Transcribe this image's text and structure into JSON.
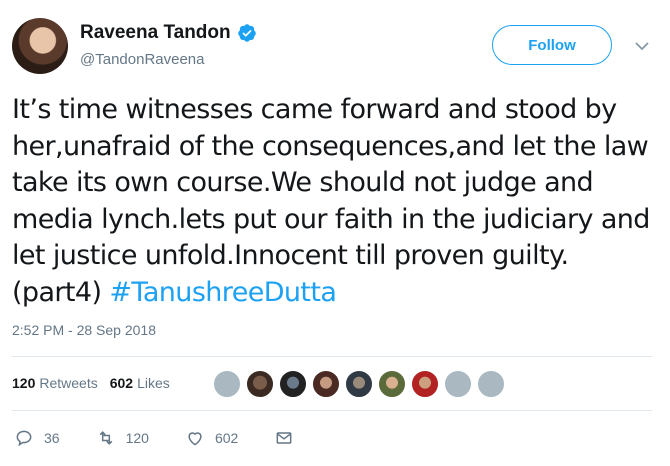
{
  "user": {
    "display_name": "Raveena Tandon",
    "handle": "@TandonRaveena",
    "verified": true
  },
  "follow_label": "Follow",
  "tweet": {
    "text": "It’s time witnesses came forward and stood by her,unafraid of the consequences,and let the law take its own course.We should not judge and media lynch.lets  put our faith in the judiciary and let justice unfold.Innocent till proven guilty.(part4) ",
    "hashtag": "#TanushreeDutta",
    "timestamp": "2:52 PM - 28 Sep 2018"
  },
  "stats": {
    "retweets_count": "120",
    "retweets_label": "Retweets",
    "likes_count": "602",
    "likes_label": "Likes"
  },
  "actions": {
    "reply_count": "36",
    "retweet_count": "120",
    "like_count": "602"
  },
  "colors": {
    "accent": "#1da1f2",
    "muted": "#657786",
    "text": "#14171a"
  },
  "icons": [
    "verified-badge-icon",
    "chevron-down-icon",
    "reply-icon",
    "retweet-icon",
    "heart-icon",
    "message-icon"
  ]
}
